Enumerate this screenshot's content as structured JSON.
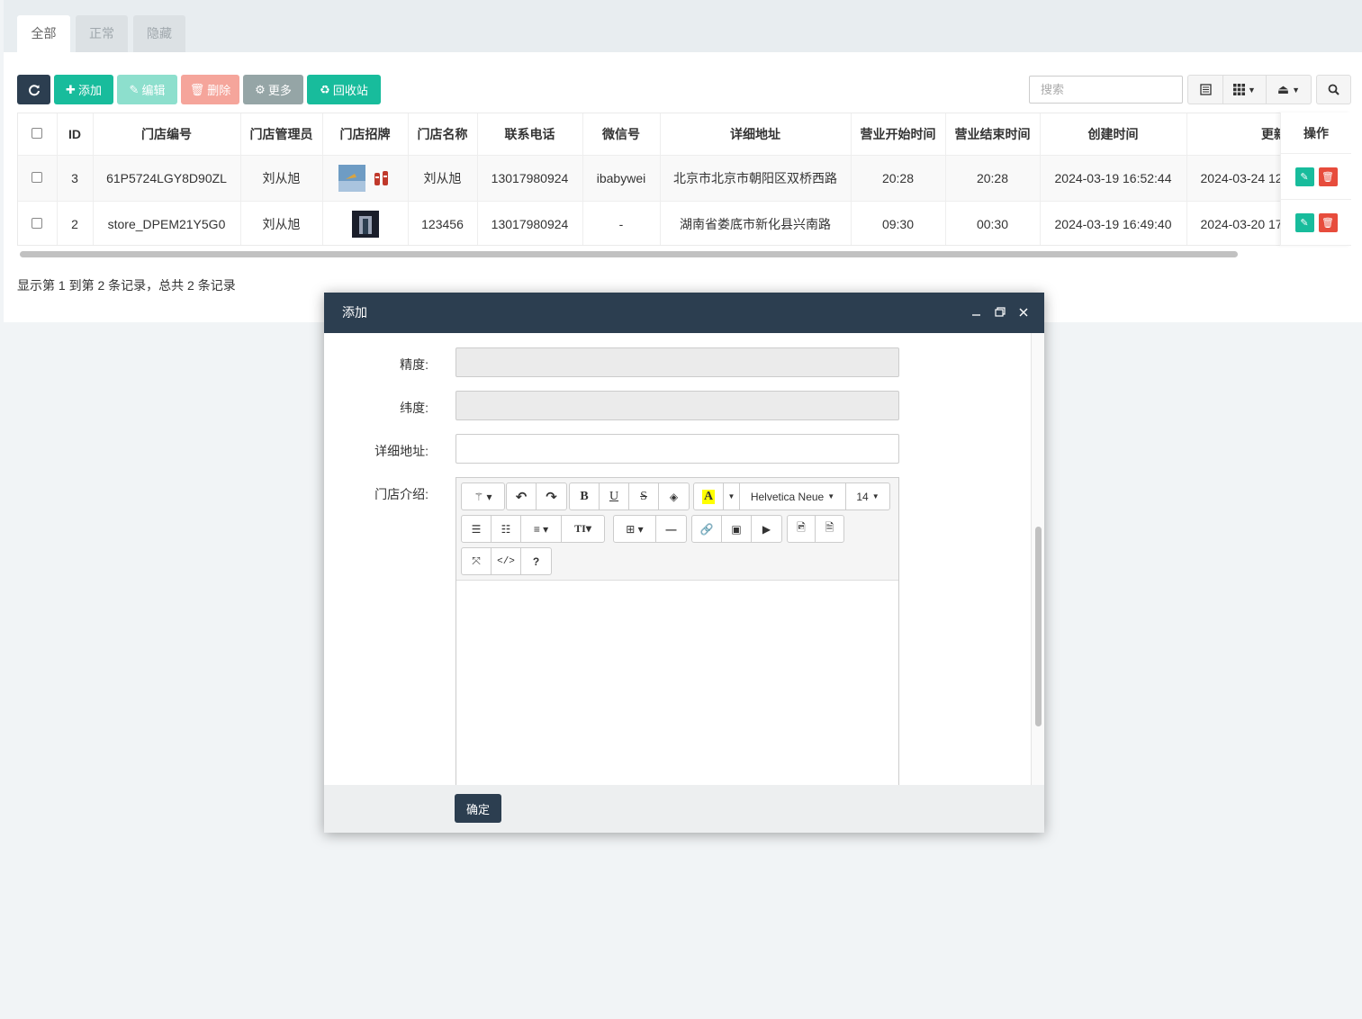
{
  "tabs": [
    "全部",
    "正常",
    "隐藏"
  ],
  "toolbar": {
    "refresh_icon": "refresh-icon",
    "add_label": "添加",
    "edit_label": "编辑",
    "delete_label": "删除",
    "more_label": "更多",
    "recycle_label": "回收站",
    "search_placeholder": "搜索"
  },
  "table": {
    "columns": [
      "ID",
      "门店编号",
      "门店管理员",
      "门店招牌",
      "门店名称",
      "联系电话",
      "微信号",
      "详细地址",
      "营业开始时间",
      "营业结束时间",
      "创建时间",
      "更新时间",
      "操作"
    ],
    "rows": [
      {
        "id": "3",
        "code": "61P5724LGY8D90ZL",
        "admin": "刘从旭",
        "name": "刘从旭",
        "phone": "13017980924",
        "wechat": "ibabywei",
        "address": "北京市北京市朝阳区双桥西路",
        "open": "20:28",
        "close": "20:28",
        "created": "2024-03-19 16:52:44",
        "updated": "2024-03-24 12"
      },
      {
        "id": "2",
        "code": "store_DPEM21Y5G0",
        "admin": "刘从旭",
        "name": "123456",
        "phone": "13017980924",
        "wechat": "-",
        "address": "湖南省娄底市新化县兴南路",
        "open": "09:30",
        "close": "00:30",
        "created": "2024-03-19 16:49:40",
        "updated": "2024-03-20 17"
      }
    ]
  },
  "footer_info": "显示第 1 到第 2 条记录，总共 2 条记录",
  "modal": {
    "title": "添加",
    "labels": {
      "longitude": "精度:",
      "latitude": "纬度:",
      "address": "详细地址:",
      "intro": "门店介绍:"
    },
    "editor": {
      "font_name": "Helvetica Neue",
      "font_size": "14"
    },
    "ok_label": "确定"
  }
}
